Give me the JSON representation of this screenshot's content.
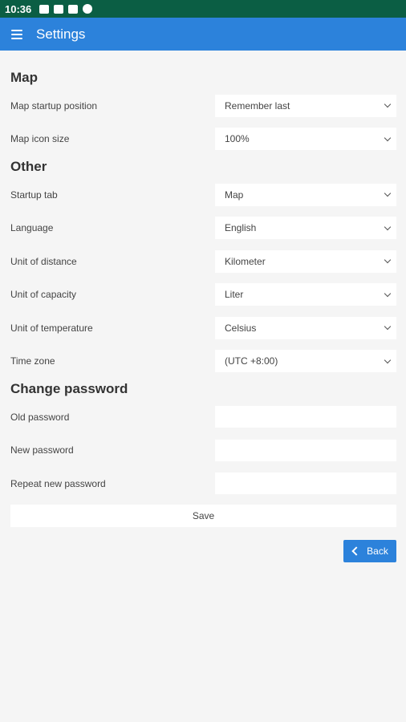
{
  "status_bar": {
    "time": "10:36"
  },
  "header": {
    "title": "Settings"
  },
  "sections": {
    "map": {
      "title": "Map",
      "startup_position": {
        "label": "Map startup position",
        "value": "Remember last"
      },
      "icon_size": {
        "label": "Map icon size",
        "value": "100%"
      }
    },
    "other": {
      "title": "Other",
      "startup_tab": {
        "label": "Startup tab",
        "value": "Map"
      },
      "language": {
        "label": "Language",
        "value": "English"
      },
      "unit_distance": {
        "label": "Unit of distance",
        "value": "Kilometer"
      },
      "unit_capacity": {
        "label": "Unit of capacity",
        "value": "Liter"
      },
      "unit_temperature": {
        "label": "Unit of temperature",
        "value": "Celsius"
      },
      "time_zone": {
        "label": "Time zone",
        "value": "(UTC +8:00)"
      }
    },
    "password": {
      "title": "Change password",
      "old": {
        "label": "Old password",
        "value": ""
      },
      "new": {
        "label": "New password",
        "value": ""
      },
      "repeat": {
        "label": "Repeat new password",
        "value": ""
      },
      "save_label": "Save"
    }
  },
  "back_label": "Back",
  "icons": {
    "menu": "hamburger-menu-icon",
    "dropdown": "chevron-down-icon",
    "back": "chevron-left-icon"
  },
  "colors": {
    "status_bar": "#0b5e44",
    "app_bar": "#2c82db",
    "background": "#f5f5f5"
  }
}
